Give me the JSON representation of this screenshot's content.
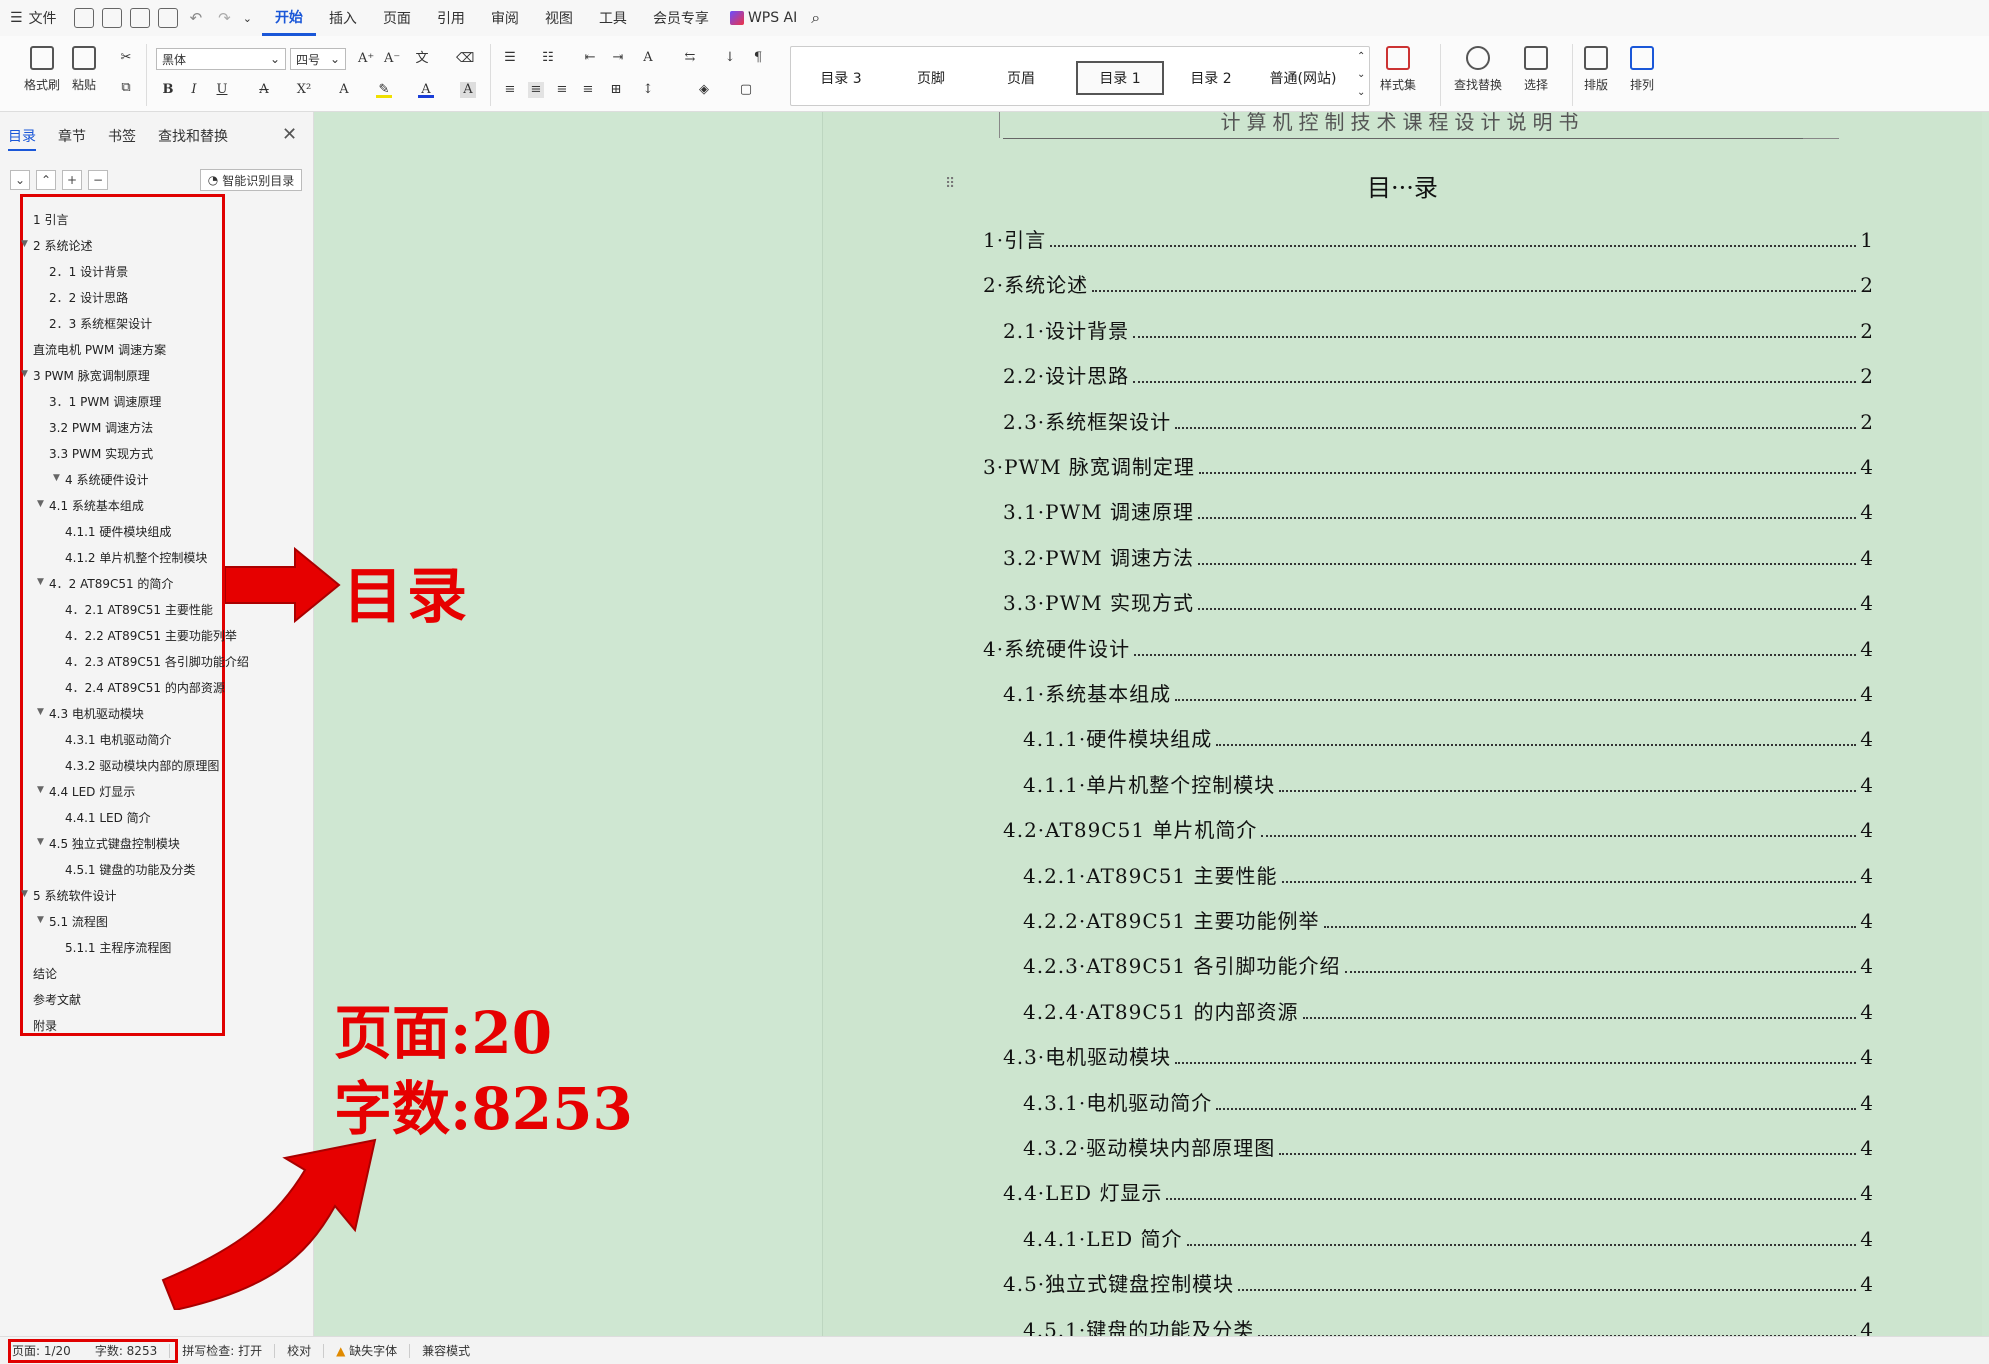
{
  "menubar": {
    "file": "文件",
    "tabs": [
      "开始",
      "插入",
      "页面",
      "引用",
      "审阅",
      "视图",
      "工具",
      "会员专享"
    ],
    "active_tab": "开始",
    "wps_ai": "WPS AI"
  },
  "ribbon": {
    "format_painter": "格式刷",
    "paste": "粘贴",
    "font_name": "黑体",
    "font_size": "四号",
    "styles": [
      "目录 3",
      "页脚",
      "页眉",
      "目录 1",
      "目录 2",
      "普通(网站)"
    ],
    "selected_style": "目录 1",
    "style_set": "样式集",
    "find_replace": "查找替换",
    "select": "选择",
    "layout": "排版",
    "arrange": "排列"
  },
  "panel": {
    "tabs": [
      "目录",
      "章节",
      "书签",
      "查找和替换"
    ],
    "active_tab": "目录",
    "smart_toc": "智能识别目录",
    "toc_items": [
      {
        "label": "1 引言",
        "indent": 0,
        "expand": false
      },
      {
        "label": "2 系统论述",
        "indent": 0,
        "expand": true
      },
      {
        "label": "2．1 设计背景",
        "indent": 1,
        "expand": false
      },
      {
        "label": "2．2 设计思路",
        "indent": 1,
        "expand": false
      },
      {
        "label": "2．3  系统框架设计",
        "indent": 1,
        "expand": false
      },
      {
        "label": "直流电机 PWM 调速方案",
        "indent": 0,
        "expand": false
      },
      {
        "label": "3 PWM 脉宽调制原理",
        "indent": 0,
        "expand": true
      },
      {
        "label": "3．1 PWM 调速原理",
        "indent": 1,
        "expand": false
      },
      {
        "label": "3.2    PWM 调速方法",
        "indent": 1,
        "expand": false
      },
      {
        "label": "3.3 PWM 实现方式",
        "indent": 1,
        "expand": false
      },
      {
        "label": "4 系统硬件设计",
        "indent": 2,
        "expand": true
      },
      {
        "label": "4.1 系统基本组成",
        "indent": 1,
        "expand": true
      },
      {
        "label": "4.1.1  硬件模块组成",
        "indent": 2,
        "expand": false
      },
      {
        "label": "4.1.2  单片机整个控制模块",
        "indent": 2,
        "expand": false
      },
      {
        "label": "4．2    AT89C51 的简介",
        "indent": 1,
        "expand": true
      },
      {
        "label": "4．2.1 AT89C51 主要性能",
        "indent": 2,
        "expand": false
      },
      {
        "label": "4．2.2 AT89C51 主要功能列举",
        "indent": 2,
        "expand": false
      },
      {
        "label": "4．2.3 AT89C51 各引脚功能介绍",
        "indent": 2,
        "expand": false
      },
      {
        "label": "4．2.4 AT89C51 的内部资源",
        "indent": 2,
        "expand": false
      },
      {
        "label": "4.3  电机驱动模块",
        "indent": 1,
        "expand": true
      },
      {
        "label": "4.3.1  电机驱动简介",
        "indent": 2,
        "expand": false
      },
      {
        "label": "4.3.2  驱动模块内部的原理图",
        "indent": 2,
        "expand": false
      },
      {
        "label": "4.4 LED 灯显示",
        "indent": 1,
        "expand": true
      },
      {
        "label": "4.4.1 LED 简介",
        "indent": 2,
        "expand": false
      },
      {
        "label": "4.5 独立式键盘控制模块",
        "indent": 1,
        "expand": true
      },
      {
        "label": "4.5.1 键盘的功能及分类",
        "indent": 2,
        "expand": false
      },
      {
        "label": "5 系统软件设计",
        "indent": 0,
        "expand": true
      },
      {
        "label": "5.1 流程图",
        "indent": 1,
        "expand": true
      },
      {
        "label": "5.1.1 主程序流程图",
        "indent": 2,
        "expand": false
      },
      {
        "label": "结论",
        "indent": 0,
        "expand": false
      },
      {
        "label": "参考文献",
        "indent": 0,
        "expand": false
      },
      {
        "label": "附录",
        "indent": 0,
        "expand": false
      }
    ]
  },
  "document": {
    "header_text": "计算机控制技术课程设计说明书",
    "title": "目···录",
    "toc_lines": [
      {
        "text": "1·引言",
        "page": "1",
        "level": 0
      },
      {
        "text": "2·系统论述",
        "page": "2",
        "level": 0
      },
      {
        "text": "2.1·设计背景",
        "page": "2",
        "level": 1
      },
      {
        "text": "2.2·设计思路",
        "page": "2",
        "level": 1
      },
      {
        "text": "2.3·系统框架设计",
        "page": "2",
        "level": 1
      },
      {
        "text": "3·PWM 脉宽调制定理",
        "page": "4",
        "level": 0
      },
      {
        "text": "3.1·PWM 调速原理",
        "page": "4",
        "level": 1
      },
      {
        "text": "3.2·PWM 调速方法",
        "page": "4",
        "level": 1
      },
      {
        "text": "3.3·PWM 实现方式",
        "page": "4",
        "level": 1
      },
      {
        "text": "4·系统硬件设计",
        "page": "4",
        "level": 0
      },
      {
        "text": "4.1·系统基本组成",
        "page": "4",
        "level": 1
      },
      {
        "text": "4.1.1·硬件模块组成",
        "page": "4",
        "level": 2
      },
      {
        "text": "4.1.1·单片机整个控制模块",
        "page": "4",
        "level": 2
      },
      {
        "text": "4.2·AT89C51 单片机简介",
        "page": "4",
        "level": 1
      },
      {
        "text": "4.2.1·AT89C51 主要性能",
        "page": "4",
        "level": 2
      },
      {
        "text": "4.2.2·AT89C51 主要功能例举",
        "page": "4",
        "level": 2
      },
      {
        "text": "4.2.3·AT89C51 各引脚功能介绍",
        "page": "4",
        "level": 2
      },
      {
        "text": "4.2.4·AT89C51 的内部资源",
        "page": "4",
        "level": 2
      },
      {
        "text": "4.3·电机驱动模块",
        "page": "4",
        "level": 1
      },
      {
        "text": "4.3.1·电机驱动简介",
        "page": "4",
        "level": 2
      },
      {
        "text": "4.3.2·驱动模块内部原理图",
        "page": "4",
        "level": 2
      },
      {
        "text": "4.4·LED 灯显示",
        "page": "4",
        "level": 1
      },
      {
        "text": "4.4.1·LED 简介",
        "page": "4",
        "level": 2
      },
      {
        "text": "4.5·独立式键盘控制模块",
        "page": "4",
        "level": 1
      },
      {
        "text": "4.5.1·键盘的功能及分类",
        "page": "4",
        "level": 2
      }
    ]
  },
  "annotations": {
    "toc_label": "目录",
    "pages_label": "页面:20",
    "words_label": "字数:8253",
    "color": "#e60000"
  },
  "status": {
    "page": "页面: 1/20",
    "words": "字数: 8253",
    "spell": "拼写检查: 打开",
    "proof": "校对",
    "missing_font": "缺失字体",
    "compat": "兼容模式"
  }
}
